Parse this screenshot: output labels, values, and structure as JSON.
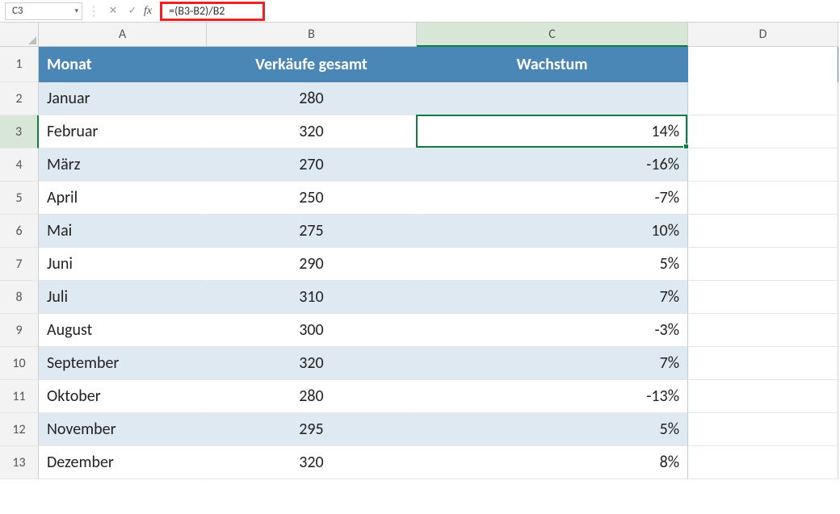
{
  "formula_bar": {
    "cell_ref": "C3",
    "formula": "=(B3-B2)/B2"
  },
  "columns": [
    "A",
    "B",
    "C",
    "D"
  ],
  "headers": {
    "month": "Monat",
    "sales": "Verkäufe gesamt",
    "growth": "Wachstum"
  },
  "rows": [
    {
      "n": 2,
      "month": "Januar",
      "sales": "280",
      "growth": ""
    },
    {
      "n": 3,
      "month": "Februar",
      "sales": "320",
      "growth": "14%"
    },
    {
      "n": 4,
      "month": "März",
      "sales": "270",
      "growth": "-16%"
    },
    {
      "n": 5,
      "month": "April",
      "sales": "250",
      "growth": "-7%"
    },
    {
      "n": 6,
      "month": "Mai",
      "sales": "275",
      "growth": "10%"
    },
    {
      "n": 7,
      "month": "Juni",
      "sales": "290",
      "growth": "5%"
    },
    {
      "n": 8,
      "month": "Juli",
      "sales": "310",
      "growth": "7%"
    },
    {
      "n": 9,
      "month": "August",
      "sales": "300",
      "growth": "-3%"
    },
    {
      "n": 10,
      "month": "September",
      "sales": "320",
      "growth": "7%"
    },
    {
      "n": 11,
      "month": "Oktober",
      "sales": "280",
      "growth": "-13%"
    },
    {
      "n": 12,
      "month": "November",
      "sales": "295",
      "growth": "5%"
    },
    {
      "n": 13,
      "month": "Dezember",
      "sales": "320",
      "growth": "8%"
    }
  ],
  "active": {
    "row": 3,
    "col": "C"
  }
}
